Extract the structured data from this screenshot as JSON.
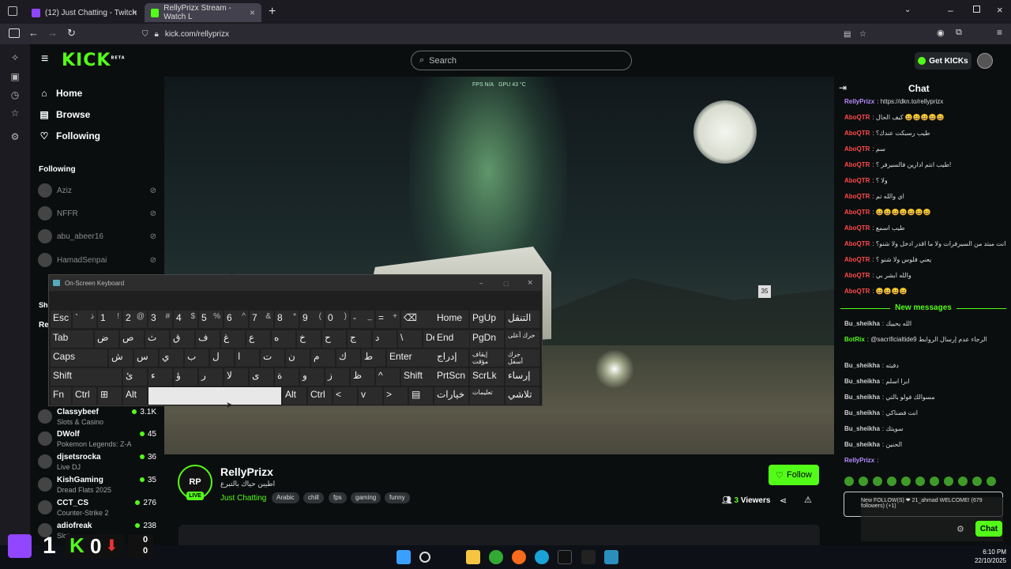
{
  "browser": {
    "tabs": [
      {
        "label": "(12) Just Chatting - Twitch",
        "favicon_color": "#9146ff"
      },
      {
        "label": "RellyPrizx Stream - Watch L",
        "favicon_color": "#53fc18"
      }
    ],
    "url": "kick.com/rellyprizx"
  },
  "header": {
    "logo": "KICK",
    "logo_beta": "BETA",
    "search_placeholder": "Search",
    "get_kicks": "Get KICKs"
  },
  "nav": {
    "home": "Home",
    "browse": "Browse",
    "following": "Following"
  },
  "following_section": {
    "title": "Following",
    "items": [
      {
        "name": "Aziz"
      },
      {
        "name": "NFFR"
      },
      {
        "name": "abu_abeer16"
      },
      {
        "name": "HamadSenpai"
      }
    ],
    "partial_labels": [
      "She",
      "Re"
    ]
  },
  "recommended": [
    {
      "name": "Classybeef",
      "category": "Slots & Casino",
      "viewers": "3.1K"
    },
    {
      "name": "DWolf",
      "category": "Pokemon Legends: Z-A",
      "viewers": "45"
    },
    {
      "name": "djsetsrocka",
      "category": "Live DJ",
      "viewers": "36"
    },
    {
      "name": "KishGaming",
      "category": "Dread Flats 2025",
      "viewers": "35"
    },
    {
      "name": "CCT_CS",
      "category": "Counter-Strike 2",
      "viewers": "276"
    },
    {
      "name": "adiofreak",
      "category": "Slots",
      "viewers": "238"
    }
  ],
  "video_overlay": {
    "fps": "FPS N/A",
    "gpu": "GPU 43 °C",
    "sign": "35"
  },
  "channel": {
    "name": "RellyPrizx",
    "avatar_text": "RP",
    "live": "LIVE",
    "title": "اطيبن حياك بالتبرع",
    "category": "Just Chatting",
    "tags": [
      "Arabic",
      "chill",
      "fps",
      "gaming",
      "funny"
    ],
    "follow": "Follow",
    "viewers": "3",
    "viewers_label": "Viewers"
  },
  "chat": {
    "title": "Chat",
    "messages": [
      {
        "user": "RellyPrizx",
        "color": "#b58cff",
        "text": "https://dkn.to/rellyprizx"
      },
      {
        "user": "AboQTR",
        "color": "#ff4a4a",
        "text": "كيف الحال 😄😄😄😄😄"
      },
      {
        "user": "AboQTR",
        "color": "#ff4a4a",
        "text": "طيب رسبكت عندك؟"
      },
      {
        "user": "AboQTR",
        "color": "#ff4a4a",
        "text": "سم"
      },
      {
        "user": "AboQTR",
        "color": "#ff4a4a",
        "text": "طيب انتم ادارين فالسيرفر ؟!"
      },
      {
        "user": "AboQTR",
        "color": "#ff4a4a",
        "text": "ولا ؟"
      },
      {
        "user": "AboQTR",
        "color": "#ff4a4a",
        "text": "اي والله تم"
      },
      {
        "user": "AboQTR",
        "color": "#ff4a4a",
        "text": "😄😄😄😄😄😄😄"
      },
      {
        "user": "AboQTR",
        "color": "#ff4a4a",
        "text": "طيب اسمع"
      },
      {
        "user": "AboQTR",
        "color": "#ff4a4a",
        "text": "انت مبتد من السيرفرات ولا ما اقدر ادخل ولا شنو؟"
      },
      {
        "user": "AboQTR",
        "color": "#ff4a4a",
        "text": "يعني فلوس ولا شنو ؟"
      },
      {
        "user": "AboQTR",
        "color": "#ff4a4a",
        "text": "والله ابشر بي"
      },
      {
        "user": "AboQTR",
        "color": "#ff4a4a",
        "text": "😄😄😄😄"
      }
    ],
    "new_messages": "New messages",
    "messages2": [
      {
        "user": "Bu_sheikha",
        "color": "#cfcfcf",
        "text": "الله يحييك"
      },
      {
        "user": "BotRix",
        "color": "#53fc18",
        "text": "@sacrificialtide9 الرجاء عدم إرسال الروابط"
      },
      {
        "user": "Bu_sheikha",
        "color": "#cfcfcf",
        "text": "دفيته"
      },
      {
        "user": "Bu_sheikha",
        "color": "#cfcfcf",
        "text": "ابرا اسلم"
      },
      {
        "user": "Bu_sheikha",
        "color": "#cfcfcf",
        "text": "مسوالك فولو بالتي"
      },
      {
        "user": "Bu_sheikha",
        "color": "#cfcfcf",
        "text": "انت فضناكي"
      },
      {
        "user": "Bu_sheikha",
        "color": "#cfcfcf",
        "text": "سويتك"
      },
      {
        "user": "Bu_sheikha",
        "color": "#cfcfcf",
        "text": "الحنين"
      },
      {
        "user": "RellyPrizx",
        "color": "#b58cff",
        "text": ""
      }
    ],
    "bot_overlay": "New FOLLOW(S) ❤ 21_ahmad WELCOME! (679 followers) (+1)",
    "send": "Chat"
  },
  "osk": {
    "title": "On-Screen Keyboard",
    "rows": [
      [
        {
          "k": "Esc"
        },
        {
          "k": "`",
          "s": "ذ"
        },
        {
          "k": "1",
          "s": "!"
        },
        {
          "k": "2",
          "s": "@"
        },
        {
          "k": "3",
          "s": "#"
        },
        {
          "k": "4",
          "s": "$"
        },
        {
          "k": "5",
          "s": "%"
        },
        {
          "k": "6",
          "s": "^"
        },
        {
          "k": "7",
          "s": "&"
        },
        {
          "k": "8",
          "s": "*"
        },
        {
          "k": "9",
          "s": "("
        },
        {
          "k": "0",
          "s": ")"
        },
        {
          "k": "-",
          "s": "_"
        },
        {
          "k": "=",
          "s": "+"
        },
        {
          "k": "⌫"
        }
      ],
      [
        {
          "k": "Tab"
        },
        {
          "k": "ض"
        },
        {
          "k": "ص"
        },
        {
          "k": "ث"
        },
        {
          "k": "ق"
        },
        {
          "k": "ف"
        },
        {
          "k": "غ"
        },
        {
          "k": "ع"
        },
        {
          "k": "ه"
        },
        {
          "k": "خ"
        },
        {
          "k": "ح"
        },
        {
          "k": "ج"
        },
        {
          "k": "د"
        },
        {
          "k": "\\"
        },
        {
          "k": "Del"
        }
      ],
      [
        {
          "k": "Caps"
        },
        {
          "k": "ش"
        },
        {
          "k": "س"
        },
        {
          "k": "ي"
        },
        {
          "k": "ب"
        },
        {
          "k": "ل"
        },
        {
          "k": "ا"
        },
        {
          "k": "ت"
        },
        {
          "k": "ن"
        },
        {
          "k": "م"
        },
        {
          "k": "ك"
        },
        {
          "k": "ط"
        },
        {
          "k": "Enter"
        }
      ],
      [
        {
          "k": "Shift"
        },
        {
          "k": "ئ"
        },
        {
          "k": "ء"
        },
        {
          "k": "ؤ"
        },
        {
          "k": "ر"
        },
        {
          "k": "لا"
        },
        {
          "k": "ى"
        },
        {
          "k": "ة"
        },
        {
          "k": "و"
        },
        {
          "k": "ز"
        },
        {
          "k": "ظ"
        },
        {
          "k": "^"
        },
        {
          "k": "Shift"
        }
      ],
      [
        {
          "k": "Fn"
        },
        {
          "k": "Ctrl"
        },
        {
          "k": "⊞"
        },
        {
          "k": "Alt"
        },
        {
          "k": ""
        },
        {
          "k": "Alt"
        },
        {
          "k": "Ctrl"
        },
        {
          "k": "<"
        },
        {
          "k": "v"
        },
        {
          "k": ">"
        },
        {
          "k": "▤"
        }
      ]
    ],
    "nav_keys": [
      [
        "Home",
        "PgUp",
        "التنقل"
      ],
      [
        "End",
        "PgDn",
        "حرك أعلى"
      ],
      [
        "إدراج",
        "إيقاف مؤقت",
        "حرك أسفل"
      ],
      [
        "PrtScn",
        "ScrLk",
        "إرساء"
      ],
      [
        "خيارات",
        "تعليمات",
        "تلاشي"
      ]
    ]
  },
  "score": {
    "left": "1",
    "mid": "0",
    "right_top": "0",
    "right_bottom": "0"
  },
  "system": {
    "time": "6:10 PM",
    "date": "22/10/2025"
  }
}
